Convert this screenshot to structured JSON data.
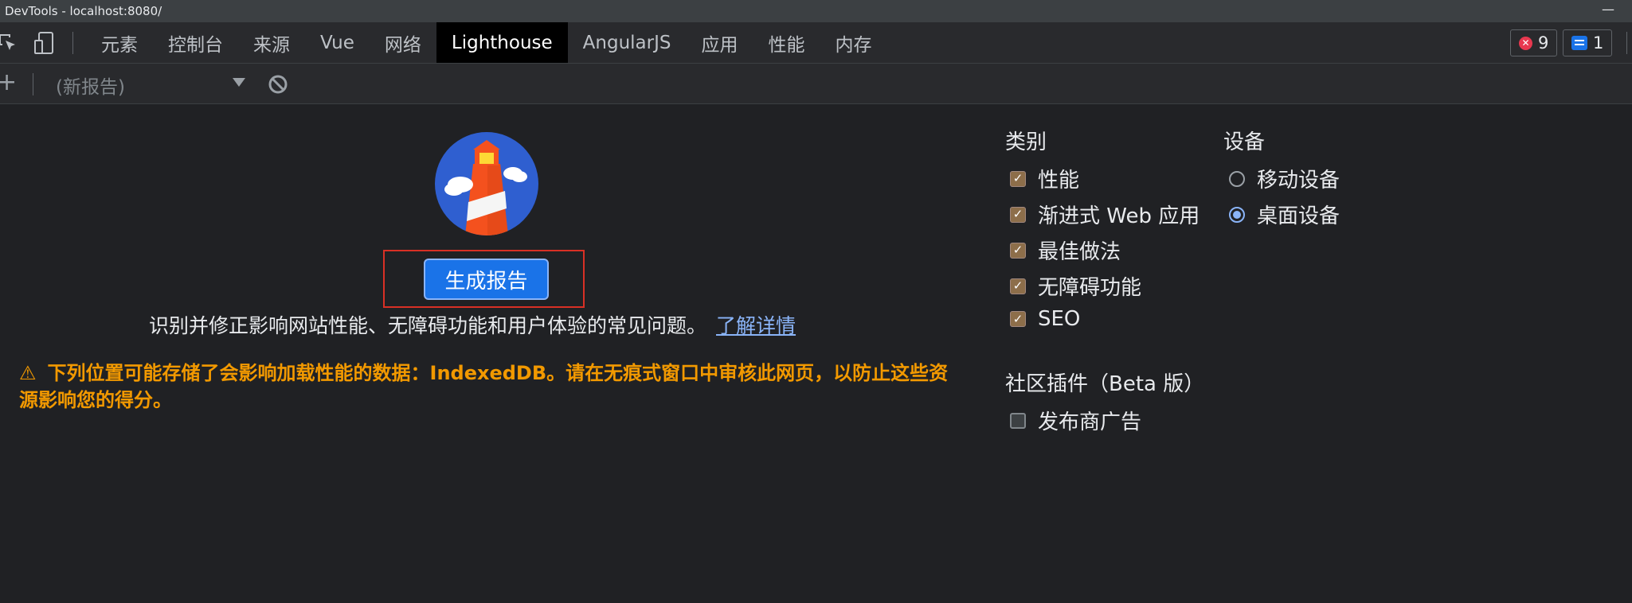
{
  "window": {
    "title": "DevTools - localhost:8080/",
    "minimize_glyph": "—"
  },
  "toolbar": {
    "inspect_icon": "inspect-element-icon",
    "device_icon": "device-toolbar-icon",
    "tabs": [
      {
        "label": "元素"
      },
      {
        "label": "控制台"
      },
      {
        "label": "来源"
      },
      {
        "label": "Vue"
      },
      {
        "label": "网络"
      },
      {
        "label": "Lighthouse"
      },
      {
        "label": "AngularJS"
      },
      {
        "label": "应用"
      },
      {
        "label": "性能"
      },
      {
        "label": "内存"
      }
    ],
    "active_tab": "Lighthouse",
    "errors_count": "9",
    "messages_count": "1"
  },
  "subtoolbar": {
    "add_glyph": "+",
    "report_select_value": "(新报告)",
    "clear_icon": "block-icon"
  },
  "main": {
    "generate_button": "生成报告",
    "description": "识别并修正影响网站性能、无障碍功能和用户体验的常见问题。",
    "learn_more": "了解详情",
    "warning_icon": "⚠",
    "warning_text": "下列位置可能存储了会影响加载性能的数据：IndexedDB。请在无痕式窗口中审核此网页，以防止这些资源影响您的得分。"
  },
  "settings": {
    "categories_title": "类别",
    "categories": [
      {
        "label": "性能",
        "checked": true
      },
      {
        "label": "渐进式 Web 应用",
        "checked": true
      },
      {
        "label": "最佳做法",
        "checked": true
      },
      {
        "label": "无障碍功能",
        "checked": true
      },
      {
        "label": "SEO",
        "checked": true
      }
    ],
    "device_title": "设备",
    "devices": [
      {
        "label": "移动设备",
        "selected": false
      },
      {
        "label": "桌面设备",
        "selected": true
      }
    ],
    "plugins_title": "社区插件（Beta 版）",
    "plugins": [
      {
        "label": "发布商广告",
        "checked": false
      }
    ],
    "check_glyph": "✓"
  },
  "colors": {
    "background": "#202124",
    "toolbar": "#292a2d",
    "accent": "#1a73e8",
    "warning": "#f29900",
    "link": "#8ab4f8",
    "highlight_box": "#d93025"
  }
}
